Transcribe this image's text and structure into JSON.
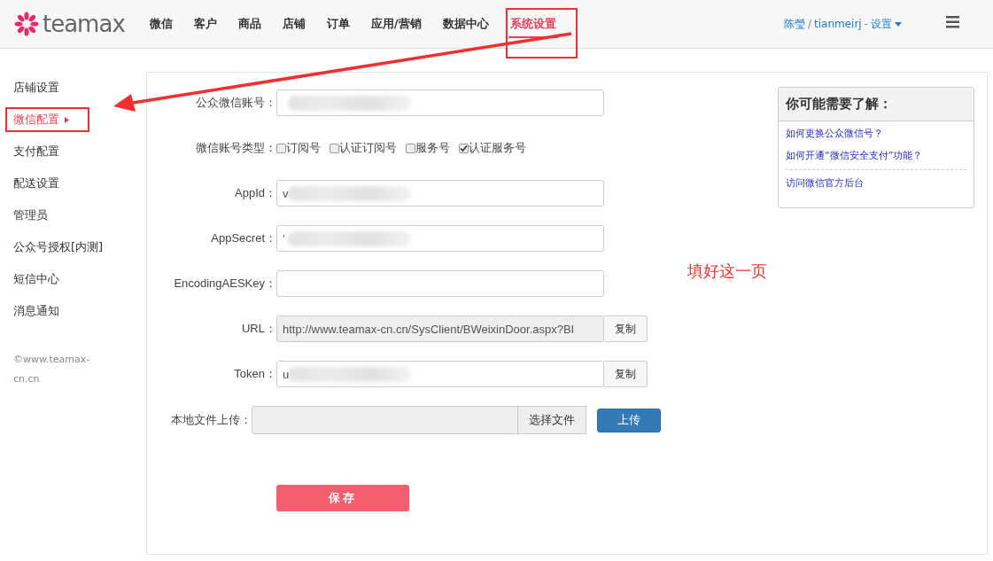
{
  "header": {
    "logo": "teamax",
    "nav": [
      {
        "label": "微信",
        "selected": false
      },
      {
        "label": "客户",
        "selected": false
      },
      {
        "label": "商品",
        "selected": false
      },
      {
        "label": "店铺",
        "selected": false
      },
      {
        "label": "订单",
        "selected": false
      },
      {
        "label": "应用/营销",
        "selected": false
      },
      {
        "label": "数据中心",
        "selected": false
      },
      {
        "label": "系统设置",
        "selected": true
      }
    ],
    "user": {
      "name": "陈瑩",
      "separator": "/",
      "account": "tianmeirj",
      "dash": "-",
      "settings": "设置"
    }
  },
  "sidebar": {
    "items": [
      {
        "label": "店铺设置",
        "selected": false
      },
      {
        "label": "微信配置",
        "selected": true
      },
      {
        "label": "支付配置",
        "selected": false
      },
      {
        "label": "配送设置",
        "selected": false
      },
      {
        "label": "管理员",
        "selected": false
      },
      {
        "label": "公众号授权[内测]",
        "selected": false
      },
      {
        "label": "短信中心",
        "selected": false
      },
      {
        "label": "消息通知",
        "selected": false
      }
    ],
    "copyright": "©www.teamax-cn.cn"
  },
  "form": {
    "rows": [
      {
        "kind": "text",
        "label": "公众微信账号：",
        "redacted": true
      },
      {
        "kind": "checks",
        "label": "微信账号类型：",
        "options": [
          {
            "label": "订阅号",
            "checked": false
          },
          {
            "label": "认证订阅号",
            "checked": false
          },
          {
            "label": "服务号",
            "checked": false
          },
          {
            "label": "认证服务号",
            "checked": true
          }
        ]
      },
      {
        "kind": "text",
        "label": "AppId：",
        "value": "v",
        "redacted": true
      },
      {
        "kind": "text",
        "label": "AppSecret：",
        "value": "'",
        "redacted": true
      },
      {
        "kind": "text",
        "label": "EncodingAESKey："
      },
      {
        "kind": "copy",
        "label": "URL：",
        "value": "http://www.teamax-cn.cn/SysClient/BWeixinDoor.aspx?BI",
        "readonly": true,
        "button": "复制"
      },
      {
        "kind": "copy",
        "label": "Token：",
        "value": "u",
        "redacted": true,
        "button": "复制"
      },
      {
        "kind": "file",
        "label": "本地文件上传：",
        "button": "选择文件",
        "upload": "上传"
      }
    ],
    "save": "保存"
  },
  "help": {
    "title": "你可能需要了解：",
    "links": [
      "如何更换公众微信号？",
      "如何开通“微信安全支付”功能？"
    ],
    "extra_link": "访问微信官方后台"
  },
  "annotation": {
    "note": "填好这一页"
  }
}
